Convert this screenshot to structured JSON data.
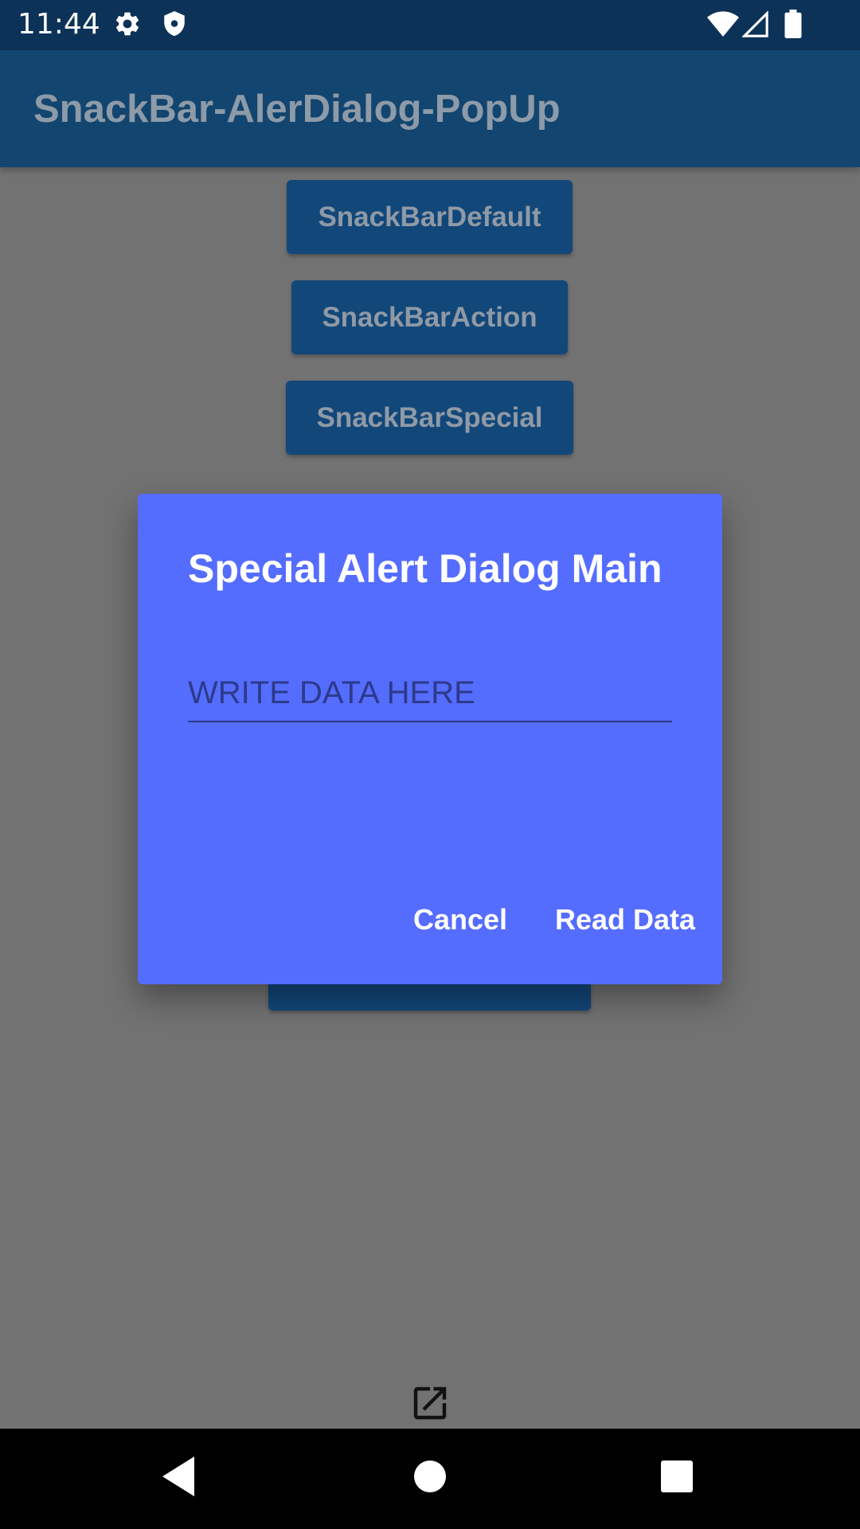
{
  "status_bar": {
    "time": "11:44",
    "icons": [
      "gear-icon",
      "shield-icon",
      "wifi-icon",
      "signal-icon",
      "battery-icon"
    ]
  },
  "app_bar": {
    "title": "SnackBar-AlerDialog-PopUp"
  },
  "main": {
    "buttons": [
      {
        "label": "SnackBarDefault"
      },
      {
        "label": "SnackBarAction"
      },
      {
        "label": "SnackBarSpecial"
      }
    ],
    "bottom_icon": "open-in-new-icon"
  },
  "dialog": {
    "title": "Special Alert Dialog Main",
    "input_placeholder": "WRITE DATA HERE",
    "input_value": "",
    "cancel_label": "Cancel",
    "read_label": "Read Data"
  },
  "nav_bar": {
    "icons": [
      "back-icon",
      "home-icon",
      "recents-icon"
    ]
  },
  "colors": {
    "status_bar": "#0d3258",
    "app_bar": "#12456f",
    "background_scrim": "#727272",
    "dialog": "#556dff",
    "button": "#12477a",
    "input_text": "#2c3a8a"
  }
}
